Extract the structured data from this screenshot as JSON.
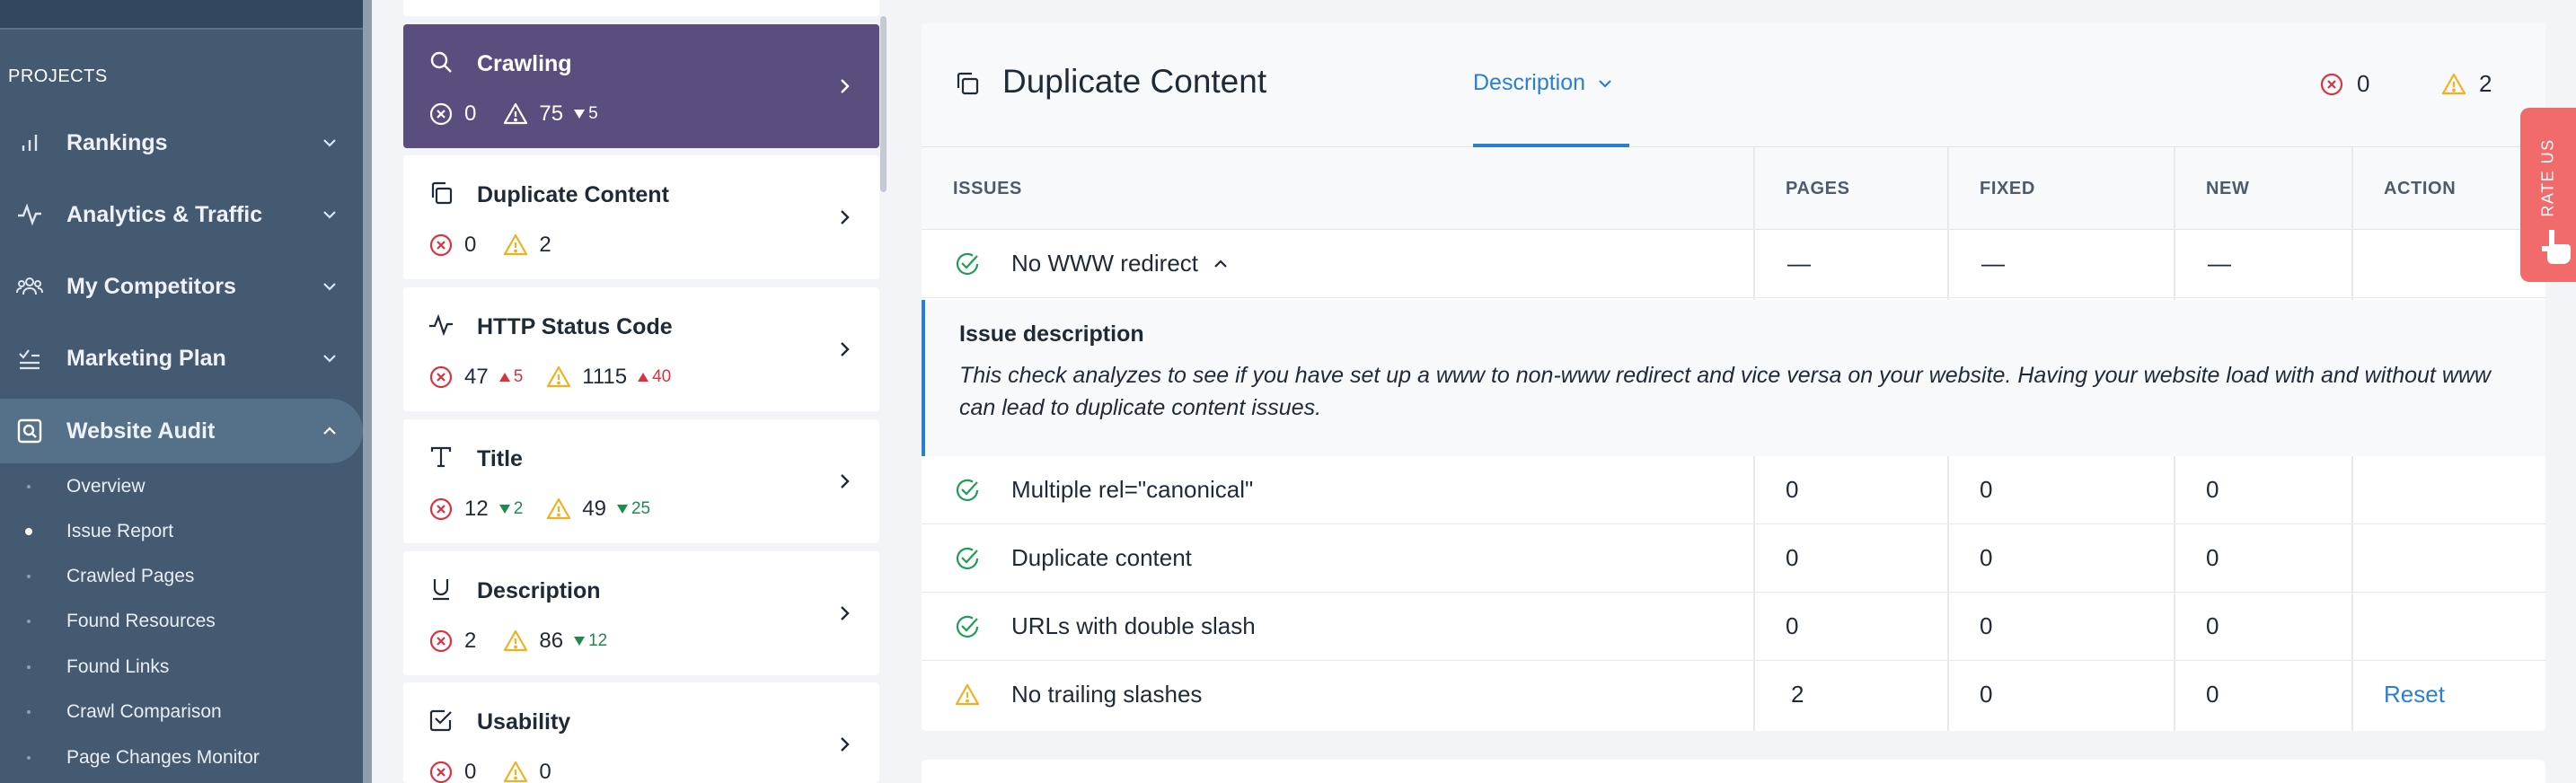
{
  "sidebar": {
    "projects_label": "PROJECTS",
    "nav": [
      {
        "label": "Rankings",
        "icon": "bar-chart-icon"
      },
      {
        "label": "Analytics & Traffic",
        "icon": "pulse-icon"
      },
      {
        "label": "My Competitors",
        "icon": "people-icon"
      },
      {
        "label": "Marketing Plan",
        "icon": "checklist-icon"
      },
      {
        "label": "Website Audit",
        "icon": "audit-icon"
      }
    ],
    "sub_items": [
      {
        "label": "Overview"
      },
      {
        "label": "Issue Report"
      },
      {
        "label": "Crawled Pages"
      },
      {
        "label": "Found Resources"
      },
      {
        "label": "Found Links"
      },
      {
        "label": "Crawl Comparison"
      },
      {
        "label": "Page Changes Monitor"
      }
    ]
  },
  "categories": [
    {
      "title": "Crawling",
      "errors": "0",
      "warnings": "75",
      "warn_delta": "5"
    },
    {
      "title": "Duplicate Content",
      "errors": "0",
      "warnings": "2"
    },
    {
      "title": "HTTP Status Code",
      "errors": "47",
      "err_delta": "5",
      "warnings": "1115",
      "warn_delta": "40"
    },
    {
      "title": "Title",
      "errors": "12",
      "err_delta": "2",
      "warnings": "49",
      "warn_delta": "25"
    },
    {
      "title": "Description",
      "errors": "2",
      "warnings": "86",
      "warn_delta": "12"
    },
    {
      "title": "Usability",
      "errors": "0",
      "warnings": "0"
    }
  ],
  "main": {
    "title": "Duplicate Content",
    "tab_label": "Description",
    "error_count": "0",
    "warning_count": "2",
    "columns": {
      "issues": "ISSUES",
      "pages": "PAGES",
      "fixed": "FIXED",
      "new": "NEW",
      "action": "ACTION"
    },
    "rows": [
      {
        "label": "No WWW redirect",
        "status": "ok",
        "pages": "—",
        "fixed": "—",
        "new": "—",
        "action": ""
      },
      {
        "label": "Multiple rel=\"canonical\"",
        "status": "ok",
        "pages": "0",
        "fixed": "0",
        "new": "0",
        "action": ""
      },
      {
        "label": "Duplicate content",
        "status": "ok",
        "pages": "0",
        "fixed": "0",
        "new": "0",
        "action": ""
      },
      {
        "label": "URLs with double slash",
        "status": "ok",
        "pages": "0",
        "fixed": "0",
        "new": "0",
        "action": ""
      },
      {
        "label": "No trailing slashes",
        "status": "warning",
        "pages": "2",
        "fixed": "0",
        "new": "0",
        "action": "Reset"
      }
    ],
    "issue_description": {
      "title": "Issue description",
      "text": "This check analyzes to see if you have set up a www to non-www redirect and vice versa on your website. Having your website load with and without www can lead to duplicate content issues."
    }
  },
  "rate_us": {
    "label": "RATE US"
  },
  "colors": {
    "sidebar": "#445a71",
    "active_card": "#5b4e7f",
    "accent": "#2b7fd1",
    "error": "#d93342",
    "warning": "#f2b01e",
    "success": "#1f9d55",
    "rate_us": "#f26b6b"
  }
}
